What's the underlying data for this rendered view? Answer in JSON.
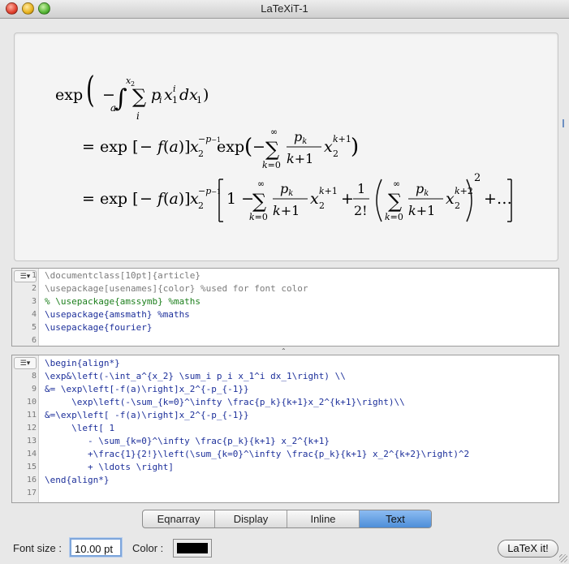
{
  "window": {
    "title": "LaTeXiT-1"
  },
  "preview": {
    "line1": {
      "lead": "exp",
      "content": "(− ∫ₐ^{x₂} ∑ᵢ pᵢ x₁ⁱ dx₁)"
    },
    "line2": {
      "content": "= exp[−f(a)] x₂^{−p−1} exp(− ∑_{k=0}^{∞} pₖ/(k+1) x₂^{k+1})"
    },
    "line3": {
      "content": "= exp[−f(a)] x₂^{−p−1} [1 − ∑_{k=0}^{∞} pₖ/(k+1) x₂^{k+1} + 1/2! (∑_{k=0}^{∞} pₖ/(k+1) x₂^{k+2})² + …]"
    }
  },
  "preamble": {
    "menu_label": "☰▾",
    "lines": [
      {
        "n": "1",
        "text": "\\documentclass[10pt]{article}",
        "color": "#7b7b7b"
      },
      {
        "n": "2",
        "text": "\\usepackage[usenames]{color} %used for font color",
        "color": "#7b7b7b"
      },
      {
        "n": "3",
        "text": "% \\usepackage{amssymb} %maths",
        "color": "#1c7f1c"
      },
      {
        "n": "4",
        "text": "\\usepackage{amsmath} %maths",
        "color": "#1c2f9a"
      },
      {
        "n": "5",
        "text": "\\usepackage{fourier}",
        "color": "#1c2f9a"
      },
      {
        "n": "6",
        "text": "",
        "color": "#1c2f9a"
      }
    ]
  },
  "body": {
    "menu_label": "☰▾",
    "lines": [
      {
        "n": "",
        "text": "\\begin{align*}"
      },
      {
        "n": "8",
        "text": "\\exp&\\left(-\\int_a^{x_2} \\sum_i p_i x_1^i dx_1\\right) \\\\"
      },
      {
        "n": "9",
        "text": "&= \\exp\\left[-f(a)\\right]x_2^{-p_{-1}}"
      },
      {
        "n": "10",
        "text": "     \\exp\\left(-\\sum_{k=0}^\\infty \\frac{p_k}{k+1}x_2^{k+1}\\right)\\\\"
      },
      {
        "n": "11",
        "text": "&=\\exp\\left[ -f(a)\\right]x_2^{-p_{-1}}"
      },
      {
        "n": "12",
        "text": "     \\left[ 1"
      },
      {
        "n": "13",
        "text": "        - \\sum_{k=0}^\\infty \\frac{p_k}{k+1} x_2^{k+1}"
      },
      {
        "n": "14",
        "text": "        +\\frac{1}{2!}\\left(\\sum_{k=0}^\\infty \\frac{p_k}{k+1} x_2^{k+2}\\right)^2"
      },
      {
        "n": "15",
        "text": "        + \\ldots \\right]"
      },
      {
        "n": "16",
        "text": "\\end{align*}"
      },
      {
        "n": "17",
        "text": ""
      }
    ]
  },
  "modes": [
    "Eqnarray",
    "Display",
    "Inline",
    "Text"
  ],
  "active_mode": "Text",
  "bottom": {
    "font_size_label": "Font size :",
    "font_size_value": "10.00 pt",
    "color_label": "Color :",
    "color_value": "#000000",
    "latex_button": "LaTeX it!"
  }
}
